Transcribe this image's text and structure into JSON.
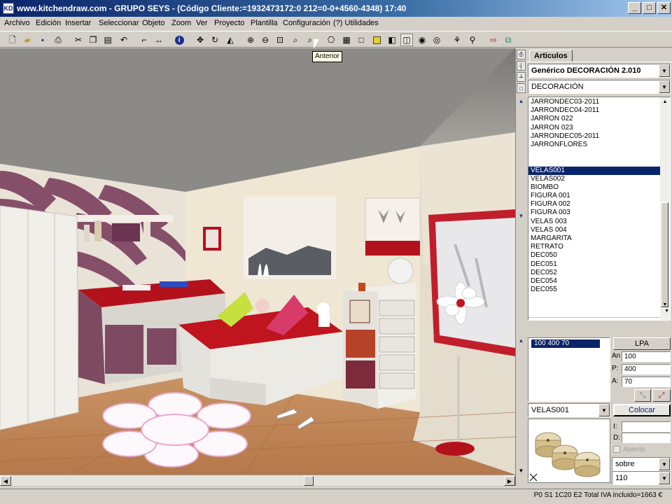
{
  "window": {
    "title": "www.kitchendraw.com - GRUPO SEYS - (Código Cliente:=1932473172:0 212=0-0+4560-4348) 17:40",
    "buttons": [
      "_",
      "□",
      "✕"
    ]
  },
  "menu": [
    "Archivo",
    "Edición",
    "Insertar",
    "Seleccionar",
    "Objeto",
    "Zoom",
    "Ver",
    "Proyecto",
    "Plantilla",
    "Configuración",
    "(?) Utilidades"
  ],
  "tooltip": "Anterior",
  "panel": {
    "tab": "Articulos",
    "catalog": "Genérico DECORACIÓN 2.010",
    "category": "DECORACIÓN",
    "articles": [
      "JARRONDEC03-2011",
      "JARRONDEC04-2011",
      "JARRON 022",
      "JARRON 023",
      "JARRONDEC05-2011",
      "JARRONFLORES",
      "",
      "",
      "VELAS001",
      "VELAS002",
      "BIOMBO",
      "FIGURA 001",
      "FIGURA 002",
      "FIGURA 003",
      "VELAS 003",
      "VELAS 004",
      "MARGARITA",
      "RETRATO",
      "DEC050",
      "DEC051",
      "DEC052",
      "DEC054",
      "DEC055"
    ],
    "selected_article": "VELAS001",
    "dims_list": [
      "100 400 70"
    ],
    "lpa_button": "LPA",
    "dims": {
      "an_label": "An",
      "an": "100",
      "p_label": "P:",
      "p": "400",
      "a_label": "A:",
      "a": "70"
    },
    "article_combo": "VELAS001",
    "colocar_button": "Colocar",
    "i_label": "I:",
    "d_label": "D:",
    "abierto_label": "Abierto",
    "position_combo": "sobre",
    "height_combo": "110"
  },
  "status": "P0 S1 1C20 E2 Total IVA incluido=1663 €",
  "colors": {
    "title_active": "#0a246a",
    "selection": "#0a246a",
    "bed_red": "#b3121c",
    "wall": "#efe6d4",
    "floor": "#c98a52"
  }
}
